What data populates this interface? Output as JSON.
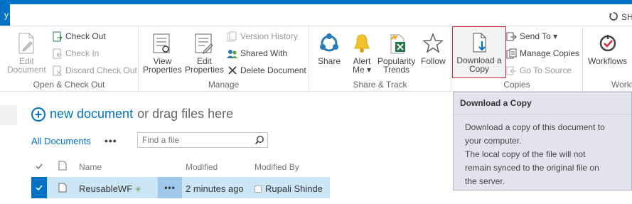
{
  "top": {
    "left_tab_glyph": "y",
    "right_label": "SH"
  },
  "ribbon": {
    "open_checkout": {
      "label": "Open & Check Out",
      "edit_document": [
        "Edit",
        "Document"
      ],
      "check_out": "Check Out",
      "check_in": "Check In",
      "discard_check_out": "Discard Check Out"
    },
    "manage": {
      "label": "Manage",
      "view_properties": [
        "View",
        "Properties"
      ],
      "edit_properties": [
        "Edit",
        "Properties"
      ],
      "version_history": "Version History",
      "shared_with": "Shared With",
      "delete_document": "Delete Document"
    },
    "share_track": {
      "label": "Share & Track",
      "share": "Share",
      "alert_me": [
        "Alert",
        "Me ▾"
      ],
      "popularity_trends": [
        "Popularity",
        "Trends"
      ],
      "follow": "Follow"
    },
    "copies": {
      "label": "Copies",
      "download_a_copy": [
        "Download a",
        "Copy"
      ],
      "send_to": "Send To ▾",
      "manage_copies": "Manage Copies",
      "go_to_source": "Go To Source"
    },
    "workflows": {
      "label": "Workfl",
      "workflows": "Workflows"
    }
  },
  "tooltip": {
    "title": "Download a Copy",
    "lines": [
      "Download a copy of this document to",
      "your computer.",
      "The local copy of the file will not",
      "remain synced to the original file on",
      "the server."
    ]
  },
  "library": {
    "new_document_link": "new document",
    "new_document_rest": "or drag files here",
    "view_name": "All Documents",
    "view_more": "•••",
    "search_placeholder": "Find a file",
    "columns": {
      "name": "Name",
      "modified": "Modified",
      "modified_by": "Modified By"
    },
    "rows": [
      {
        "name": "ReusableWF",
        "new_badge": "✳",
        "menu": "•••",
        "modified": "2 minutes ago",
        "modified_by": "Rupali Shinde"
      }
    ]
  },
  "colors": {
    "accent": "#0072c6",
    "selected_row": "#cde6f7",
    "highlight_border": "#c8303c"
  }
}
